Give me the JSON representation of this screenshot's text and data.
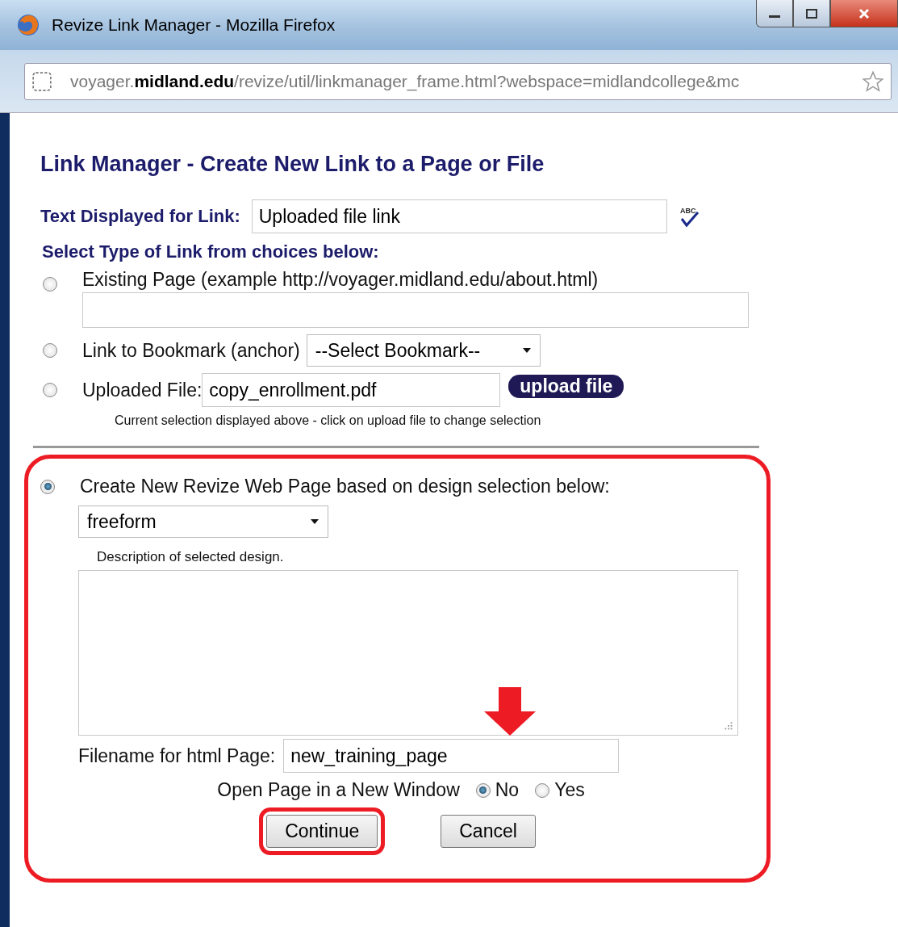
{
  "window": {
    "title": "Revize Link Manager - Mozilla Firefox"
  },
  "address_bar": {
    "url": "voyager.**midland.edu**/revize/util/linkmanager_frame.html?webspace=midlandcollege&mc"
  },
  "heading": "Link Manager - Create New Link to a Page or File",
  "link_text": {
    "label": "Text Displayed for Link:",
    "value": "Uploaded file link",
    "spellcheck_mark": "ABC"
  },
  "type_prompt": "Select Type of Link from choices below:",
  "link_types": [
    {
      "kind": "url",
      "label": "Existing Page (example http://voyager.midland.edu/about.html)",
      "selected": false
    },
    {
      "kind": "bookmark",
      "label": "Link to Bookmark (anchor)",
      "selected": false,
      "select_value": "--Select Bookmark--"
    },
    {
      "kind": "file",
      "label": "Uploaded File:",
      "selected": false,
      "value": "copy_enrollment.pdf",
      "button": "upload file",
      "note": "Current selection displayed above - click on upload file to change selection"
    },
    {
      "kind": "new_page",
      "label": "Create New Revize Web Page based on design selection below:",
      "selected": true,
      "highlighted": true,
      "design": "freeform",
      "description_label": "Description of selected design.",
      "filename_label": "Filename for html Page:",
      "filename": "new_training_page"
    }
  ],
  "new_window": {
    "label": "Open Page in a New Window",
    "options": [
      {
        "label": "No",
        "selected": true
      },
      {
        "label": "Yes",
        "selected": false
      }
    ]
  },
  "buttons": [
    {
      "label": "Continue",
      "highlighted": true
    },
    {
      "label": "Cancel",
      "highlighted": false
    }
  ]
}
